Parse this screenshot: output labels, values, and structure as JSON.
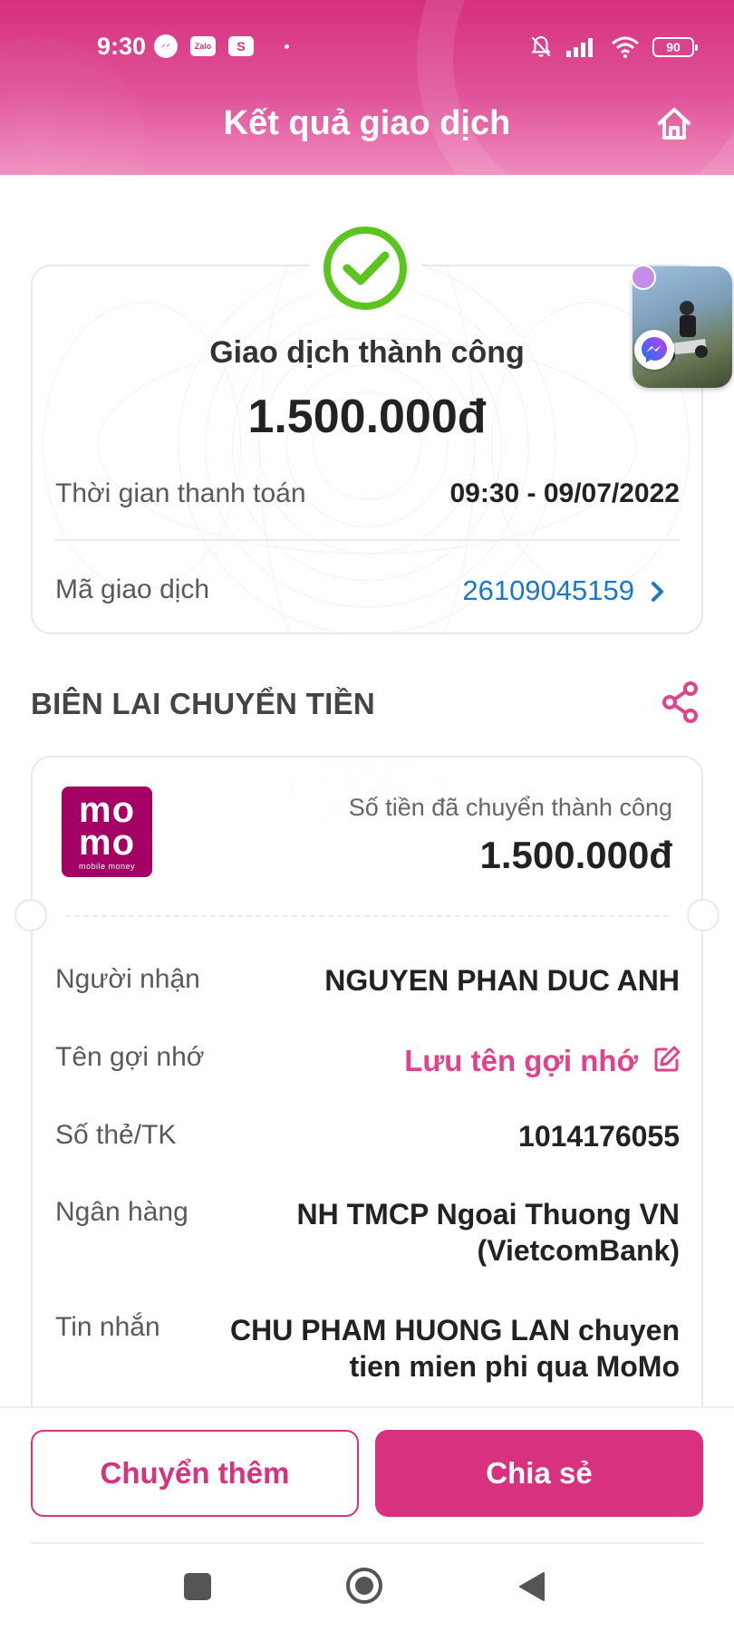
{
  "status_bar": {
    "time": "9:30",
    "app_icons": [
      "messenger-icon",
      "zalo-icon",
      "shopee-icon"
    ],
    "zalo_text": "Zalo",
    "shopee_text": "S",
    "battery": "90"
  },
  "header": {
    "title": "Kết quả giao dịch",
    "home_icon": "home-icon"
  },
  "result": {
    "status": "Giao dịch thành công",
    "amount": "1.500.000đ",
    "time_label": "Thời gian thanh toán",
    "time_value": "09:30 - 09/07/2022",
    "txn_label": "Mã giao dịch",
    "txn_value": "26109045159"
  },
  "receipt": {
    "section_title": "BIÊN LAI CHUYỂN TIỀN",
    "logo_line1": "mo",
    "logo_line2": "mo",
    "logo_sub": "mobile money",
    "sent_label": "Số tiền đã chuyển thành công",
    "sent_amount": "1.500.000đ",
    "recipient_label": "Người nhận",
    "recipient_value": "NGUYEN PHAN DUC ANH",
    "nickname_label": "Tên gợi nhớ",
    "nickname_action": "Lưu tên gợi nhớ",
    "account_label": "Số thẻ/TK",
    "account_value": "1014176055",
    "bank_label": "Ngân hàng",
    "bank_value_line1": "NH TMCP Ngoai Thuong VN",
    "bank_value_line2": "(VietcomBank)",
    "message_label": "Tin nhắn",
    "message_value_line1": "CHU PHAM HUONG LAN chuyen",
    "message_value_line2": "tien mien phi qua MoMo"
  },
  "actions": {
    "transfer_more": "Chuyển thêm",
    "share": "Chia sẻ"
  },
  "colors": {
    "brand": "#d8317f",
    "momo": "#a50064",
    "link_blue": "#1a78c9",
    "success_green": "#5cc41f"
  }
}
